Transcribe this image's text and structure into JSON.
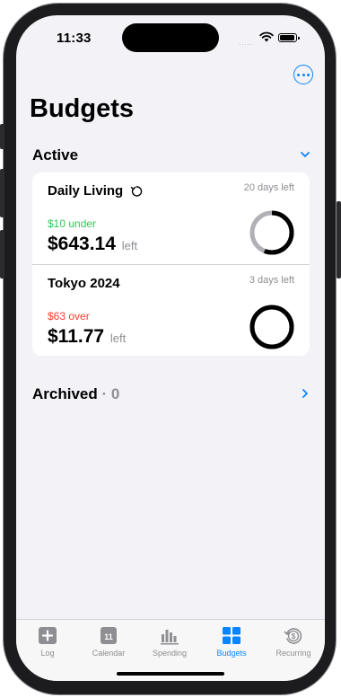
{
  "status_bar": {
    "time": "11:33",
    "signal": "....."
  },
  "header": {
    "title": "Budgets"
  },
  "sections": {
    "active": {
      "label": "Active"
    },
    "archived": {
      "label": "Archived",
      "count": "· 0"
    }
  },
  "budgets": [
    {
      "name": "Daily Living",
      "days_left": "20 days left",
      "status": "$10 under",
      "amount": "$643.14",
      "left_label": "left",
      "progress": 0.56
    },
    {
      "name": "Tokyo 2024",
      "days_left": "3 days left",
      "status": "$63 over",
      "amount": "$11.77",
      "left_label": "left",
      "progress": 1.0
    }
  ],
  "tabs": [
    {
      "label": "Log",
      "icon": "plus-square-icon"
    },
    {
      "label": "Calendar",
      "icon": "calendar-icon",
      "badge": "11"
    },
    {
      "label": "Spending",
      "icon": "bar-chart-icon"
    },
    {
      "label": "Budgets",
      "icon": "grid-icon",
      "selected": true
    },
    {
      "label": "Recurring",
      "icon": "recurring-dollar-icon"
    }
  ],
  "colors": {
    "accent": "#0a84ff",
    "under": "#34c759",
    "over": "#ff3b30",
    "ring_track": "#b0b0b5",
    "ring_fill": "#000000"
  }
}
